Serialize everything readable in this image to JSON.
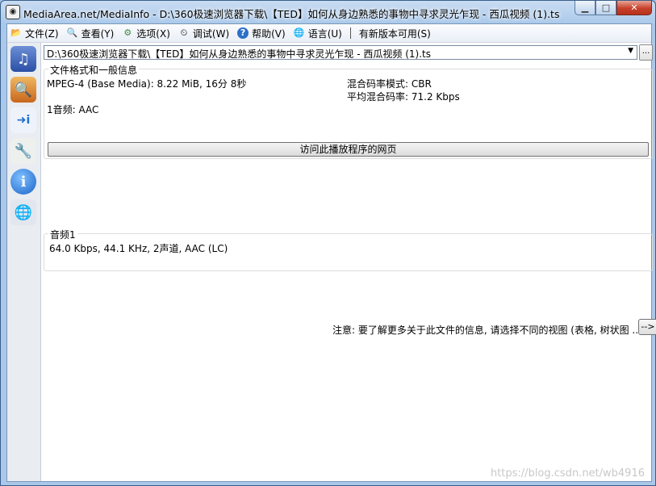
{
  "window": {
    "title": "MediaArea.net/MediaInfo - D:\\360极速浏览器下载\\【TED】如何从身边熟悉的事物中寻求灵光乍现 - 西瓜视频 (1).ts",
    "app_icon_glyph": "◉",
    "minimize_glyph": "▁",
    "maximize_glyph": "□",
    "close_glyph": "✕"
  },
  "menu": {
    "items": [
      {
        "label": "文件(Z)",
        "icon": "file-menu-icon",
        "glyph": "📂"
      },
      {
        "label": "查看(Y)",
        "icon": "view-menu-icon",
        "glyph": "🔍"
      },
      {
        "label": "选项(X)",
        "icon": "options-menu-icon",
        "glyph": "⚙"
      },
      {
        "label": "调试(W)",
        "icon": "debug-menu-icon",
        "glyph": "⏲"
      },
      {
        "label": "帮助(V)",
        "icon": "help-menu-icon",
        "glyph": "?"
      },
      {
        "label": "语言(U)",
        "icon": "language-menu-icon",
        "glyph": "🌐"
      }
    ],
    "update_notice": "有新版本可用(S)"
  },
  "sidebar": {
    "icons": [
      {
        "name": "open-file-icon",
        "glyph": "♫"
      },
      {
        "name": "open-folder-icon",
        "glyph": "🔍"
      },
      {
        "name": "export-icon",
        "glyph": "➜i"
      },
      {
        "name": "preferences-icon",
        "glyph": "🔧"
      },
      {
        "name": "about-icon",
        "glyph": "i"
      },
      {
        "name": "web-icon",
        "glyph": "🌐"
      }
    ]
  },
  "file_selector": {
    "value": "D:\\360极速浏览器下载\\【TED】如何从身边熟悉的事物中寻求灵光乍现 - 西瓜视频 (1).ts",
    "arrow": "▼",
    "browse_label": "..."
  },
  "general": {
    "title": "文件格式和一般信息",
    "format_line": "MPEG-4 (Base Media): 8.22 MiB, 16分 8秒",
    "audio_line": "1音频: AAC",
    "bitrate_mode": "混合码率模式: CBR",
    "overall_bitrate": "平均混合码率: 71.2 Kbps",
    "visit_button": "访问此播放程序的网页"
  },
  "audio": {
    "title": "音频1",
    "details": "64.0 Kbps, 44.1 KHz, 2声道, AAC (LC)"
  },
  "note": {
    "text": "注意: 要了解更多关于此文件的信息, 请选择不同的视图 (表格, 树状图 ...)",
    "button": "-->"
  },
  "watermark": "https://blog.csdn.net/wb4916",
  "colors": {
    "titlebar": "#a9c8ea",
    "close_button": "#c7402a",
    "sidebar": "#e9ecf1"
  }
}
